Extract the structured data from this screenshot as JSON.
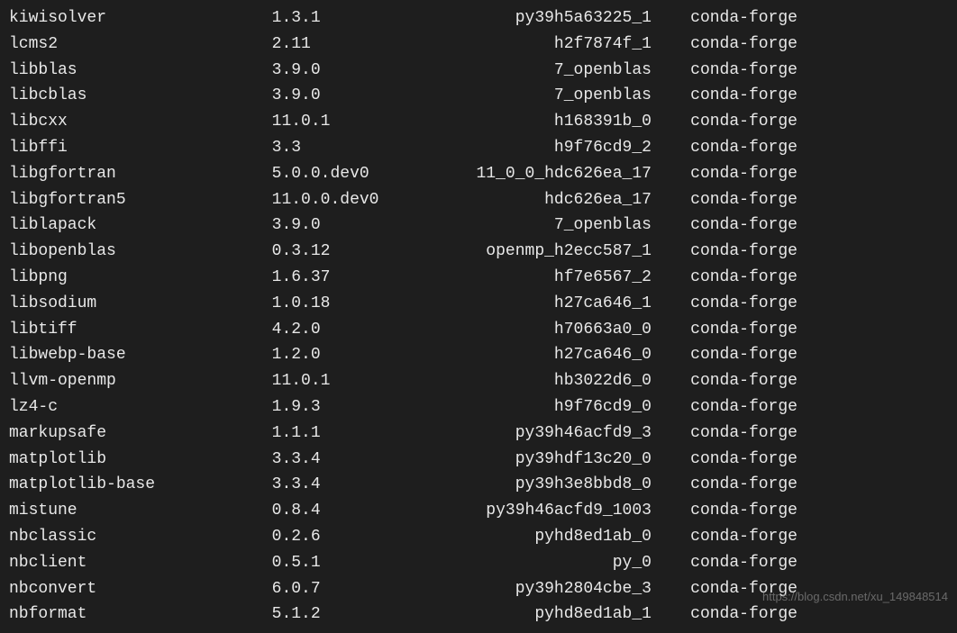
{
  "packages": [
    {
      "name": "kiwisolver",
      "version": "1.3.1",
      "build": "py39h5a63225_1",
      "channel": "conda-forge"
    },
    {
      "name": "lcms2",
      "version": "2.11",
      "build": "h2f7874f_1",
      "channel": "conda-forge"
    },
    {
      "name": "libblas",
      "version": "3.9.0",
      "build": "7_openblas",
      "channel": "conda-forge"
    },
    {
      "name": "libcblas",
      "version": "3.9.0",
      "build": "7_openblas",
      "channel": "conda-forge"
    },
    {
      "name": "libcxx",
      "version": "11.0.1",
      "build": "h168391b_0",
      "channel": "conda-forge"
    },
    {
      "name": "libffi",
      "version": "3.3",
      "build": "h9f76cd9_2",
      "channel": "conda-forge"
    },
    {
      "name": "libgfortran",
      "version": "5.0.0.dev0",
      "build": "11_0_0_hdc626ea_17",
      "channel": "conda-forge"
    },
    {
      "name": "libgfortran5",
      "version": "11.0.0.dev0",
      "build": "hdc626ea_17",
      "channel": "conda-forge"
    },
    {
      "name": "liblapack",
      "version": "3.9.0",
      "build": "7_openblas",
      "channel": "conda-forge"
    },
    {
      "name": "libopenblas",
      "version": "0.3.12",
      "build": "openmp_h2ecc587_1",
      "channel": "conda-forge"
    },
    {
      "name": "libpng",
      "version": "1.6.37",
      "build": "hf7e6567_2",
      "channel": "conda-forge"
    },
    {
      "name": "libsodium",
      "version": "1.0.18",
      "build": "h27ca646_1",
      "channel": "conda-forge"
    },
    {
      "name": "libtiff",
      "version": "4.2.0",
      "build": "h70663a0_0",
      "channel": "conda-forge"
    },
    {
      "name": "libwebp-base",
      "version": "1.2.0",
      "build": "h27ca646_0",
      "channel": "conda-forge"
    },
    {
      "name": "llvm-openmp",
      "version": "11.0.1",
      "build": "hb3022d6_0",
      "channel": "conda-forge"
    },
    {
      "name": "lz4-c",
      "version": "1.9.3",
      "build": "h9f76cd9_0",
      "channel": "conda-forge"
    },
    {
      "name": "markupsafe",
      "version": "1.1.1",
      "build": "py39h46acfd9_3",
      "channel": "conda-forge"
    },
    {
      "name": "matplotlib",
      "version": "3.3.4",
      "build": "py39hdf13c20_0",
      "channel": "conda-forge"
    },
    {
      "name": "matplotlib-base",
      "version": "3.3.4",
      "build": "py39h3e8bbd8_0",
      "channel": "conda-forge"
    },
    {
      "name": "mistune",
      "version": "0.8.4",
      "build": "py39h46acfd9_1003",
      "channel": "conda-forge"
    },
    {
      "name": "nbclassic",
      "version": "0.2.6",
      "build": "pyhd8ed1ab_0",
      "channel": "conda-forge"
    },
    {
      "name": "nbclient",
      "version": "0.5.1",
      "build": "py_0",
      "channel": "conda-forge"
    },
    {
      "name": "nbconvert",
      "version": "6.0.7",
      "build": "py39h2804cbe_3",
      "channel": "conda-forge"
    },
    {
      "name": "nbformat",
      "version": "5.1.2",
      "build": "pyhd8ed1ab_1",
      "channel": "conda-forge"
    }
  ],
  "columns": {
    "name_width": 27,
    "version_width": 17,
    "build_width": 22,
    "channel_width": 15
  },
  "watermark": "https://blog.csdn.net/xu_149848514"
}
